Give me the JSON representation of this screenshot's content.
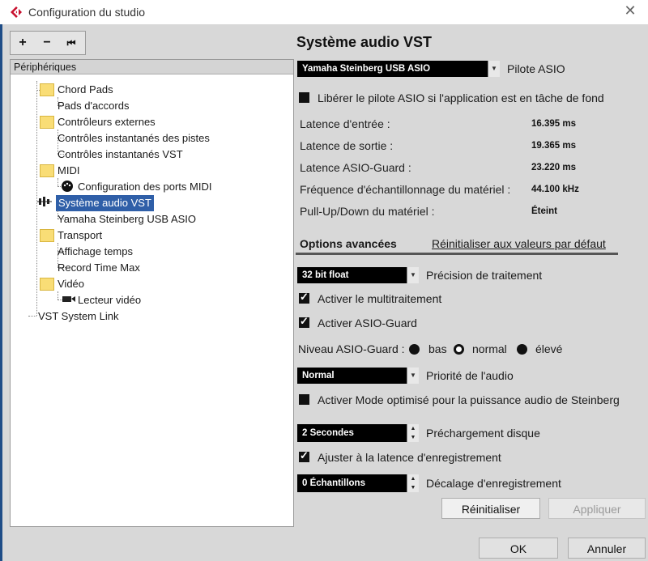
{
  "window": {
    "title": "Configuration du studio",
    "close_glyph": "✕"
  },
  "toolbar": {
    "add": "+",
    "remove": "−",
    "reset": "⏮"
  },
  "tree": {
    "header": "Périphériques",
    "items": [
      {
        "label": "Chord Pads"
      },
      {
        "label": "Pads d'accords"
      },
      {
        "label": "Contrôleurs externes"
      },
      {
        "label": "Contrôles instantanés des pistes"
      },
      {
        "label": "Contrôles instantanés VST"
      },
      {
        "label": "MIDI"
      },
      {
        "label": "Configuration des ports MIDI"
      },
      {
        "label": "Système audio VST"
      },
      {
        "label": "Yamaha Steinberg USB ASIO"
      },
      {
        "label": "Transport"
      },
      {
        "label": "Affichage temps"
      },
      {
        "label": "Record Time Max"
      },
      {
        "label": "Vidéo"
      },
      {
        "label": "Lecteur vidéo"
      },
      {
        "label": "VST System Link"
      }
    ]
  },
  "panel": {
    "title": "Système audio VST",
    "driver": {
      "value": "Yamaha Steinberg USB ASIO",
      "label": "Pilote ASIO"
    },
    "release_driver": {
      "label": "Libérer le pilote ASIO si l'application est en tâche de fond",
      "checked": false
    },
    "stats": [
      {
        "label": "Latence d'entrée :",
        "value": "16.395 ms"
      },
      {
        "label": "Latence de sortie :",
        "value": "19.365 ms"
      },
      {
        "label": "Latence ASIO-Guard :",
        "value": "23.220 ms"
      },
      {
        "label": "Fréquence d'échantillonnage du matériel :",
        "value": "44.100 kHz"
      },
      {
        "label": "Pull-Up/Down du matériel :",
        "value": "Éteint"
      }
    ],
    "advanced": {
      "title": "Options avancées",
      "reset_link": "Réinitialiser aux valeurs par défaut"
    },
    "precision": {
      "value": "32 bit float",
      "label": "Précision de traitement"
    },
    "multiprocessing": {
      "label": "Activer le multitraitement",
      "checked": true
    },
    "asio_guard": {
      "label": "Activer ASIO-Guard",
      "checked": true
    },
    "asio_guard_level": {
      "label": "Niveau ASIO-Guard :",
      "options": [
        "bas",
        "normal",
        "élevé"
      ],
      "selected": "normal"
    },
    "audio_priority": {
      "value": "Normal",
      "label": "Priorité de l'audio"
    },
    "steinberg_mode": {
      "label": "Activer Mode optimisé pour la puissance audio de Steinberg",
      "checked": false
    },
    "disk_preload": {
      "value": "2 Secondes",
      "label": "Préchargement disque"
    },
    "adjust_latency": {
      "label": "Ajuster à la latence d'enregistrement",
      "checked": true
    },
    "record_offset": {
      "value": "0 Échantillons",
      "label": "Décalage d'enregistrement"
    },
    "buttons": {
      "reset": "Réinitialiser",
      "apply": "Appliquer"
    }
  },
  "footer": {
    "ok": "OK",
    "cancel": "Annuler"
  },
  "colors": {
    "selection": "#2f5fa8",
    "window_bg": "#d8d8d8",
    "accent_bar": "#1f4d87",
    "app_icon": "#c8102e"
  }
}
